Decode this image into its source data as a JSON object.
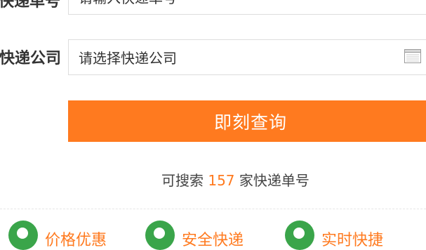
{
  "form": {
    "tracking_label": "快递单号",
    "tracking_placeholder": "请输入快递单号",
    "courier_label": "快递公司",
    "courier_placeholder": "请选择快递公司",
    "submit_label": "即刻查询"
  },
  "stats": {
    "prefix": "可搜索",
    "count": "157",
    "suffix": "家快递单号"
  },
  "features": [
    {
      "label": "价格优惠",
      "icon": "price-icon"
    },
    {
      "label": "安全快递",
      "icon": "location-icon"
    },
    {
      "label": "实时快捷",
      "icon": "clock-icon"
    }
  ],
  "colors": {
    "accent": "#ff7a1f",
    "feature_icon": "#3aa54a"
  }
}
